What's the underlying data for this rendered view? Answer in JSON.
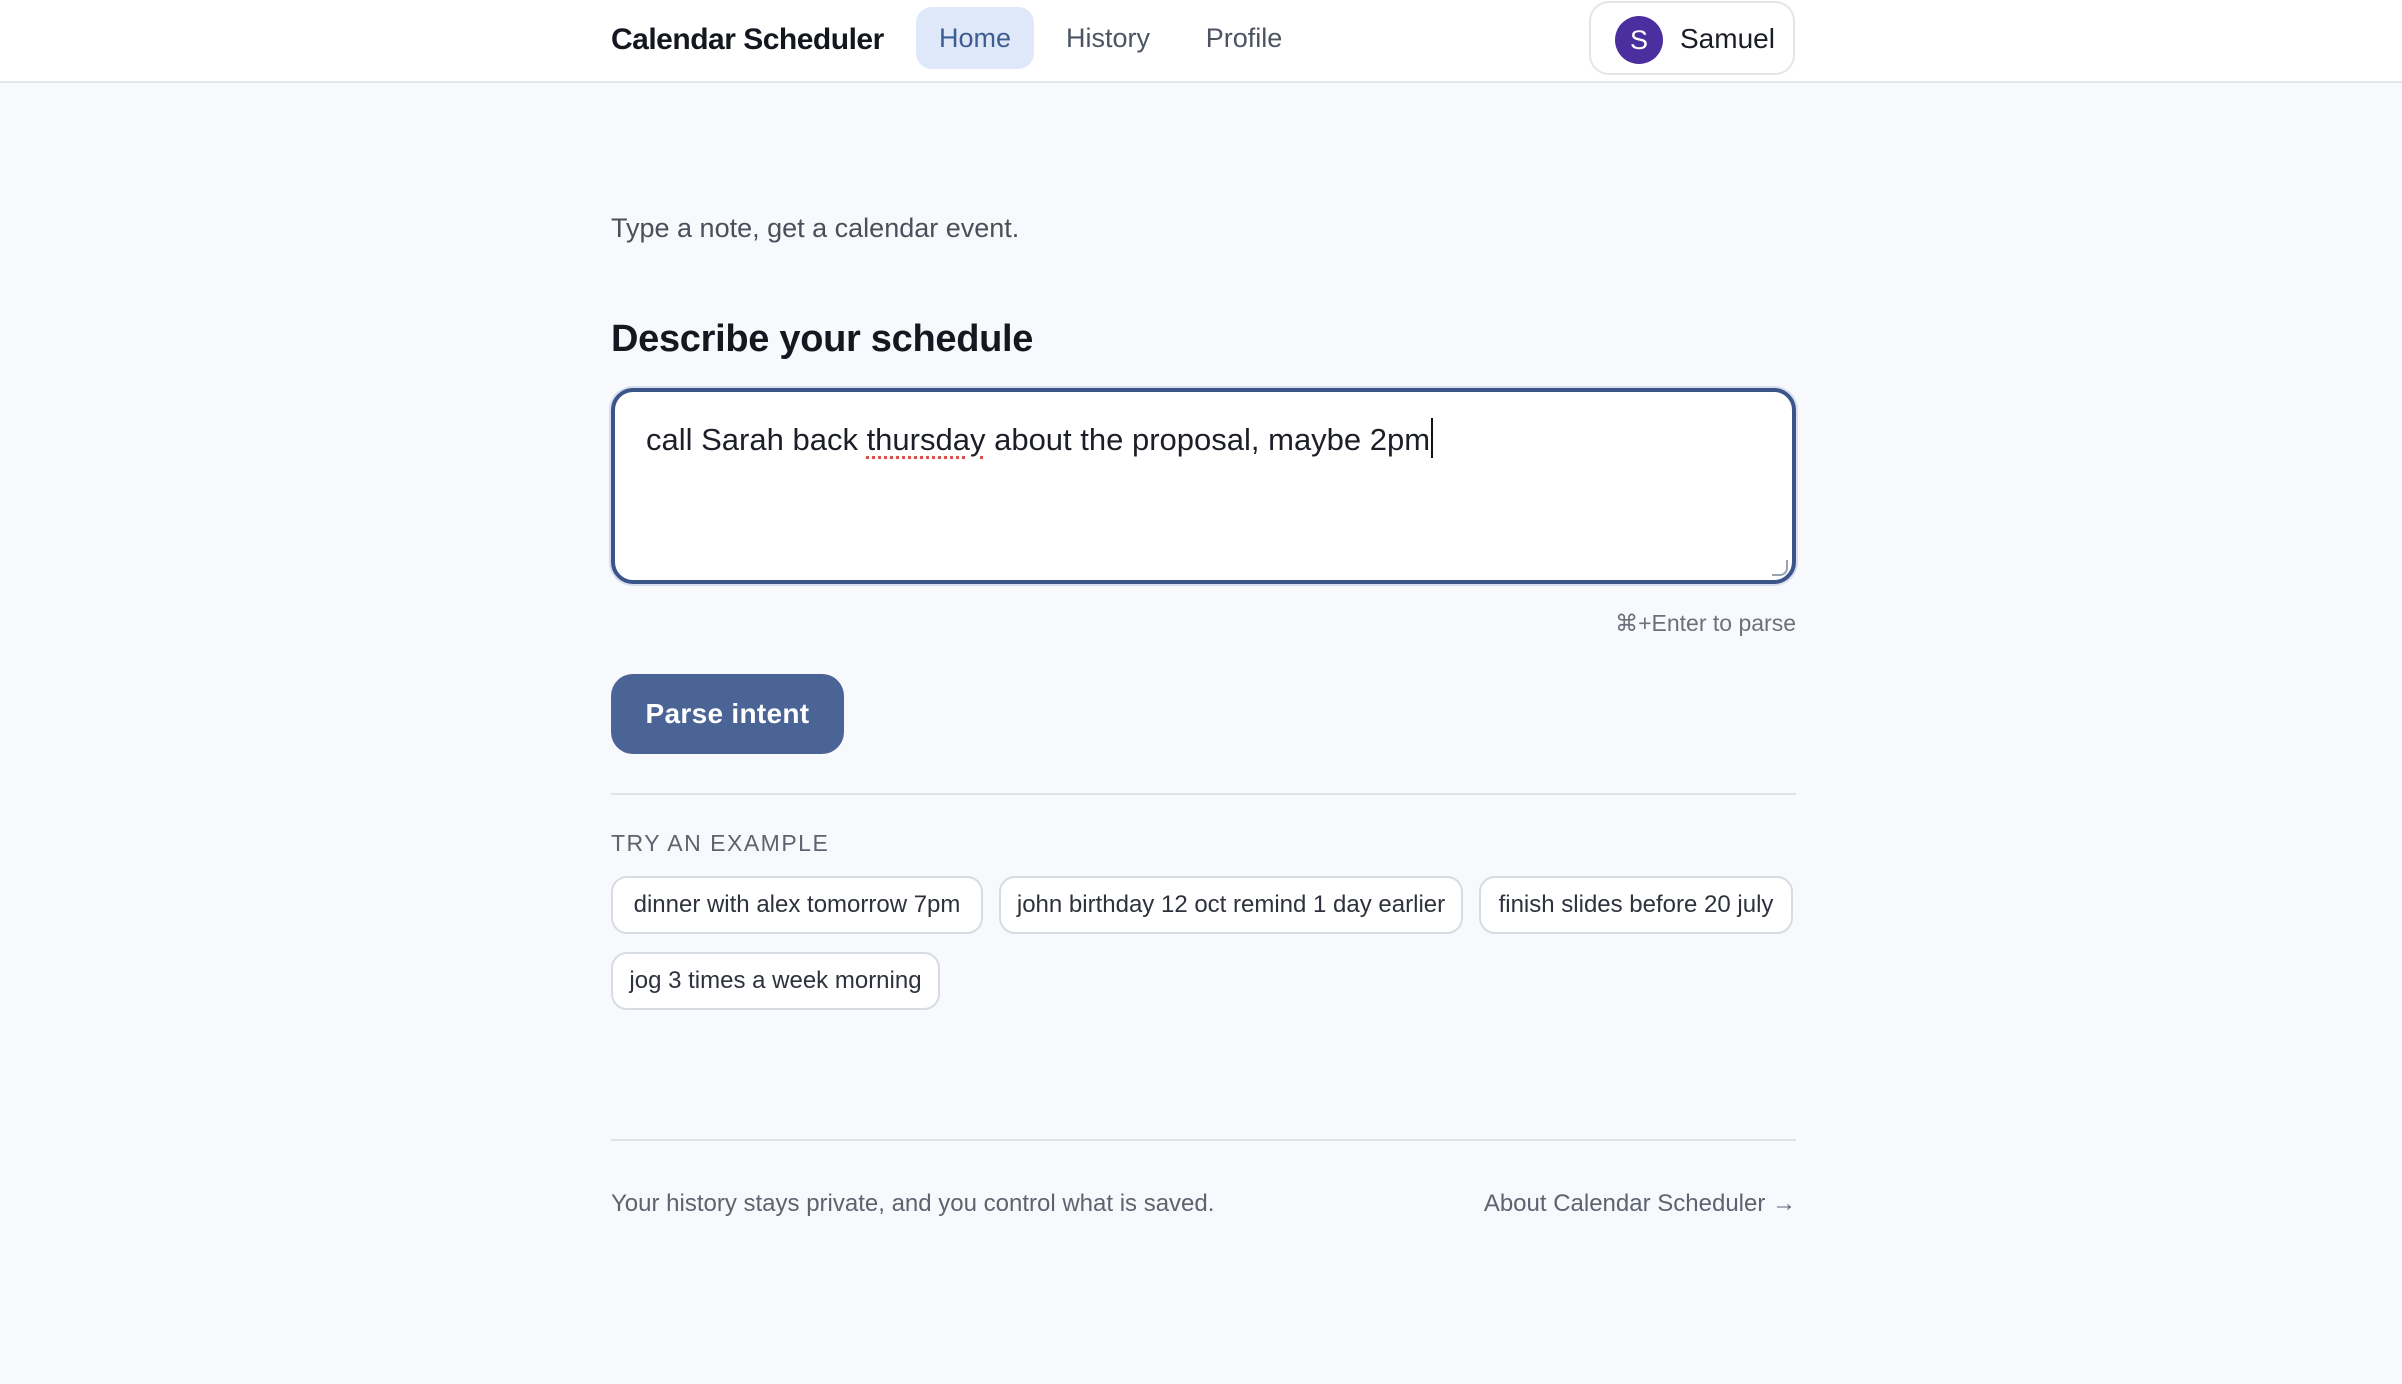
{
  "header": {
    "brand": "Calendar Scheduler",
    "nav": [
      {
        "label": "Home",
        "active": true
      },
      {
        "label": "History",
        "active": false
      },
      {
        "label": "Profile",
        "active": false
      }
    ],
    "user": {
      "initial": "S",
      "name": "Samuel"
    }
  },
  "main": {
    "tagline": "Type a note, get a calendar event.",
    "section_title": "Describe your schedule",
    "note": {
      "before": "call Sarah back ",
      "misspelled": "thursday",
      "after": " about the proposal, maybe 2pm"
    },
    "shortcut_hint": "⌘+Enter to parse",
    "parse_button": "Parse intent",
    "examples_label": "TRY AN EXAMPLE",
    "examples": [
      "dinner with alex tomorrow 7pm",
      "john birthday 12 oct remind 1 day earlier",
      "finish slides before 20 july",
      "jog 3 times a week morning"
    ]
  },
  "footer": {
    "privacy_note": "Your history stays private, and you control what is saved.",
    "about_link": "About Calendar Scheduler →"
  },
  "colors": {
    "accent": "#4a6496",
    "nav_active_bg": "#dfe8f8",
    "avatar": "#4b2f9e",
    "page_bg": "#f8f9fc"
  }
}
